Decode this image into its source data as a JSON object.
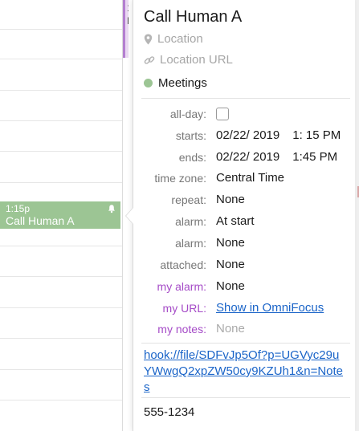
{
  "calendar": {
    "purple_event": {
      "text_line1": "1",
      "text_line2": "N"
    },
    "green_event": {
      "time": "1:15p",
      "title": "Call Human A",
      "color": "#9cc594"
    }
  },
  "popover": {
    "title": "Call Human A",
    "location_placeholder": "Location",
    "location_url_placeholder": "Location URL",
    "calendar_name": "Meetings",
    "calendar_color": "#9cc594",
    "fields": {
      "allday_label": "all-day:",
      "allday_checked": false,
      "starts_label": "starts:",
      "starts_date": "02/22/ 2019",
      "starts_time": "1: 15 PM",
      "ends_label": "ends:",
      "ends_date": "02/22/ 2019",
      "ends_time": "1:45 PM",
      "timezone_label": "time zone:",
      "timezone_value": "Central Time",
      "repeat_label": "repeat:",
      "repeat_value": "None",
      "alarm1_label": "alarm:",
      "alarm1_value": "At start",
      "alarm2_label": "alarm:",
      "alarm2_value": "None",
      "attached_label": "attached:",
      "attached_value": "None",
      "myalarm_label": "my alarm:",
      "myalarm_value": "None",
      "myurl_label": "my URL:",
      "myurl_value": "Show in OmniFocus",
      "mynotes_label": "my notes:",
      "mynotes_value": "None"
    },
    "custom_label_color": "#a54bc7",
    "link_color": "#1a64c8",
    "hook_url": "hook://file/SDFvJp5Of?p=UGVyc29uYWwgQ2xpZW50cy9KZUh1&n=Notes",
    "phone": "555-1234"
  }
}
